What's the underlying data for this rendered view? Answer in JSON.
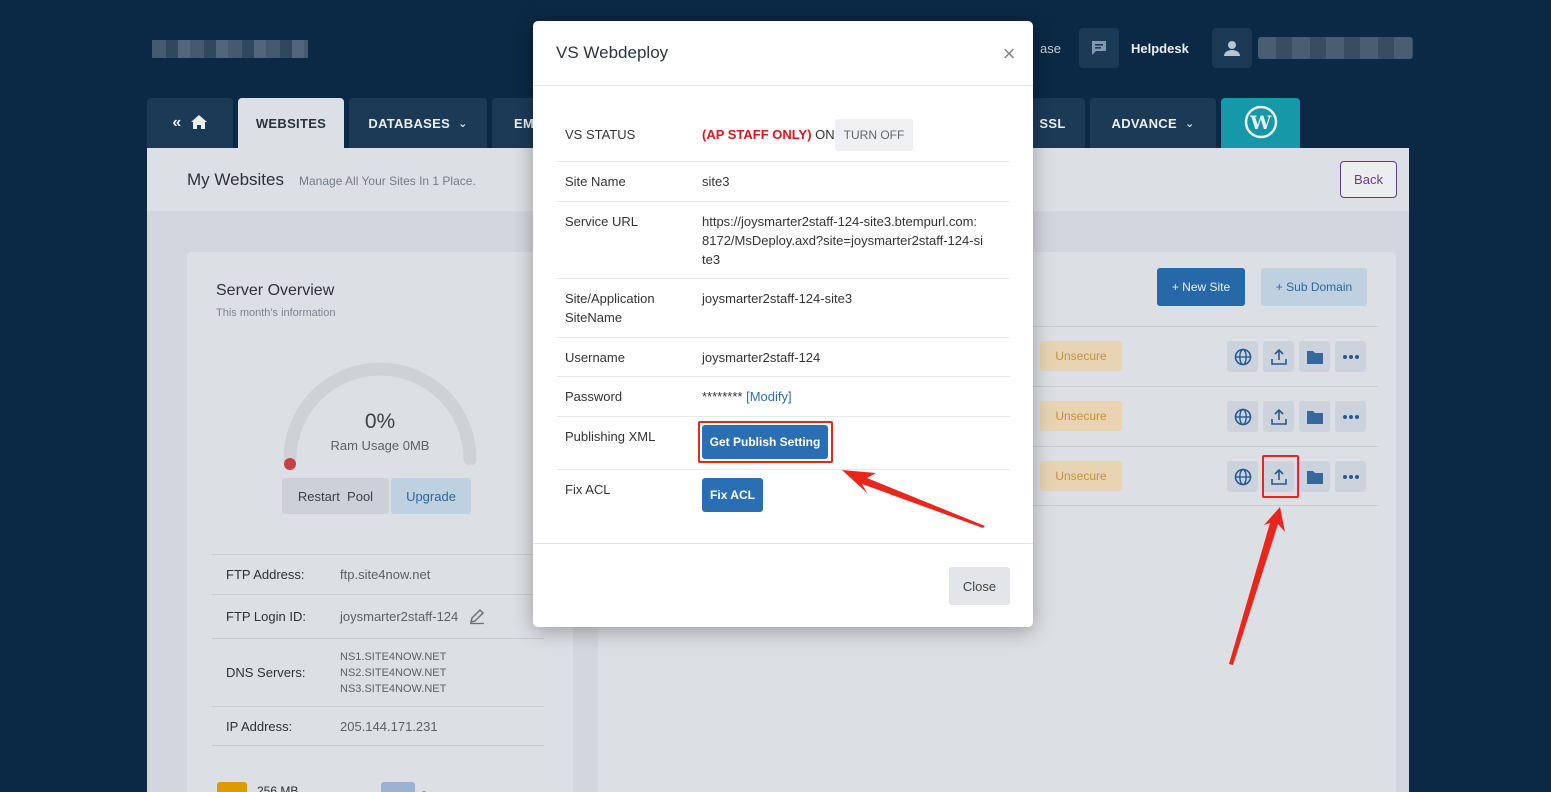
{
  "header": {
    "partial_link": "ase",
    "helpdesk_label": "Helpdesk",
    "icons": {
      "helpdesk": "chat-bubble-icon",
      "user": "user-icon"
    }
  },
  "nav": {
    "home_icon": "home-icon",
    "tabs": [
      {
        "label": "WEBSITES",
        "active": true
      },
      {
        "label": "DATABASES",
        "dropdown": true
      },
      {
        "label": "EM"
      },
      {
        "label": "SSL"
      },
      {
        "label": "ADVANCE",
        "dropdown": true
      }
    ],
    "wordpress_icon": "wordpress-icon"
  },
  "page": {
    "title": "My Websites",
    "subtitle": "Manage All Your Sites In 1 Place.",
    "back_label": "Back"
  },
  "server_overview": {
    "title": "Server Overview",
    "subtitle": "This month's information",
    "ram_percent": "0%",
    "ram_label": "Ram Usage 0MB",
    "ram_fraction": 0,
    "restart_label": "Restart  Pool",
    "upgrade_label": "Upgrade",
    "ftp_address_label": "FTP Address:",
    "ftp_address": "ftp.site4now.net",
    "ftp_login_label": "FTP Login ID:",
    "ftp_login": "joysmarter2staff-124",
    "dns_label": "DNS Servers:",
    "dns": [
      "NS1.SITE4NOW.NET",
      "NS2.SITE4NOW.NET",
      "NS3.SITE4NOW.NET"
    ],
    "ip_label": "IP Address:",
    "ip": "205.144.171.231",
    "mem_partial": "256 MB",
    "second_partial": "-"
  },
  "sites": {
    "new_site_label": "+ New Site",
    "sub_domain_label": "+ Sub Domain",
    "rows": [
      {
        "ssl_status": "Unsecure"
      },
      {
        "ssl_status": "Unsecure"
      },
      {
        "ssl_status": "Unsecure"
      }
    ],
    "action_icons": [
      "globe-icon",
      "upload-icon",
      "folder-icon",
      "more-icon"
    ]
  },
  "modal": {
    "title": "VS Webdeploy",
    "vs_status_label": "VS STATUS",
    "vs_status_staff": "(AP STAFF ONLY)",
    "vs_status_value": "ON",
    "turn_off_label": "TURN OFF",
    "site_name_label": "Site Name",
    "site_name": "site3",
    "service_url_label": "Service URL",
    "service_url_lines": [
      "https://joysmarter2staff-124-site3.btempurl.com:",
      "8172/MsDeploy.axd?site=joysmarter2staff-124-si",
      "te3"
    ],
    "app_sitename_label_1": "Site/Application",
    "app_sitename_label_2": "SiteName",
    "app_sitename": "joysmarter2staff-124-site3",
    "username_label": "Username",
    "username": "joysmarter2staff-124",
    "password_label": "Password",
    "password_mask": "********",
    "modify_label": "[Modify]",
    "publishing_label": "Publishing XML",
    "publish_button": "Get Publish Setting",
    "fix_acl_label": "Fix ACL",
    "fix_acl_button": "Fix ACL",
    "close_label": "Close"
  },
  "colors": {
    "background": "#0b2a47",
    "nav_tab": "#1d3d5b",
    "primary": "#2a6fb4",
    "danger": "#e0141e",
    "annotation": "#e8261c",
    "warning_bg": "#fbe4bf"
  }
}
